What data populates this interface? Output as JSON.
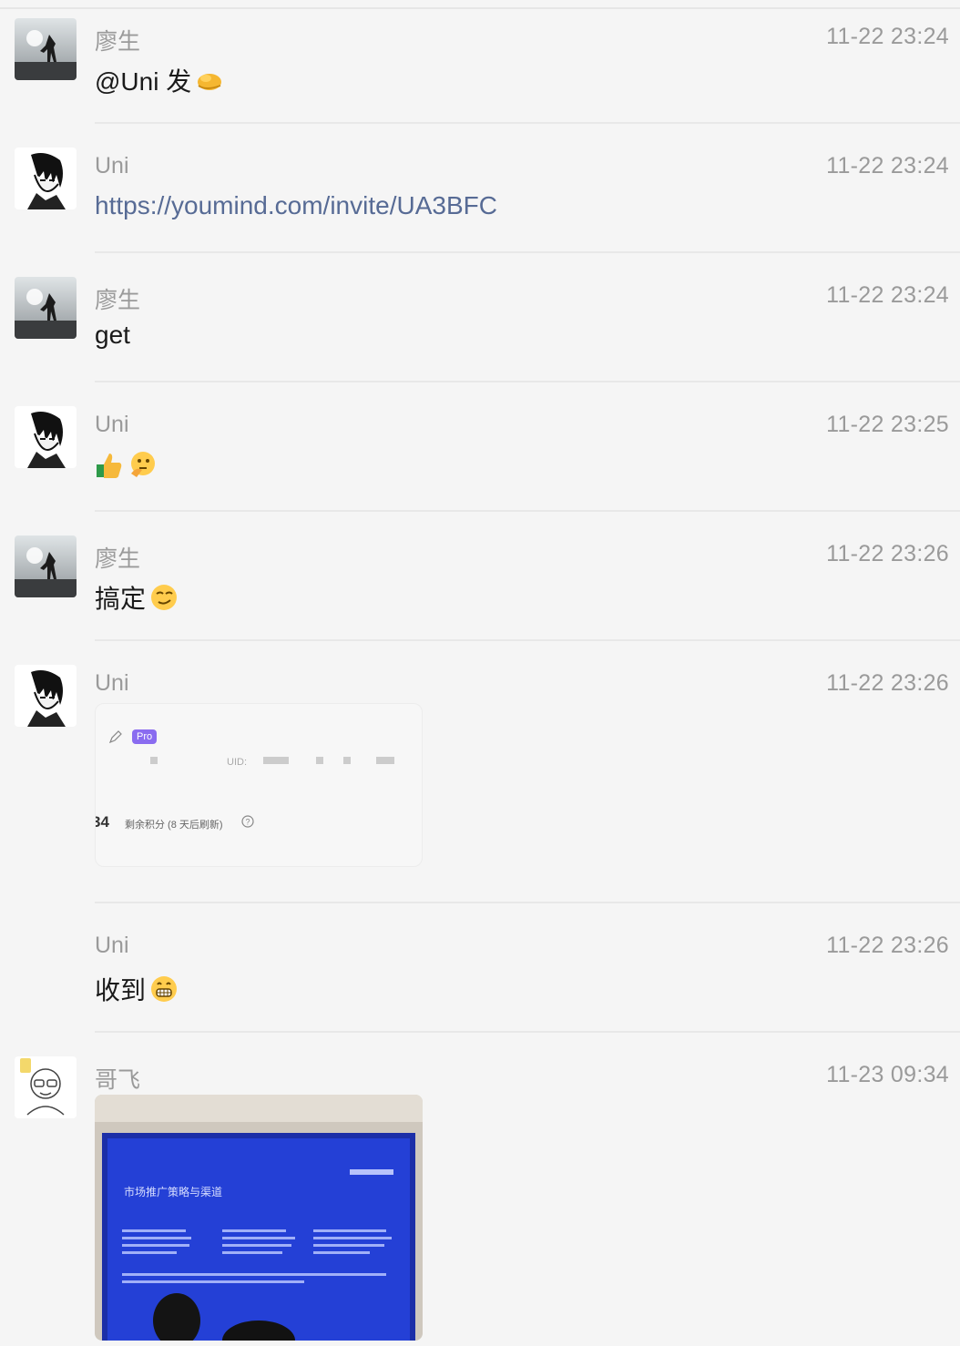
{
  "messages": [
    {
      "sender": "廖生",
      "time": "11-22 23:24",
      "text": "@Uni 发",
      "emoji_icon": "clap-hands-icon",
      "avatar_icon": "person-silhouette-avatar"
    },
    {
      "sender": "Uni",
      "time": "11-22 23:24",
      "text": "https://youmind.com/invite/UA3BFC",
      "avatar_icon": "manga-character-avatar"
    },
    {
      "sender": "廖生",
      "time": "11-22 23:24",
      "text": "get",
      "avatar_icon": "person-silhouette-avatar"
    },
    {
      "sender": "Uni",
      "time": "11-22 23:25",
      "emoji_icons": [
        "thumbs-up-icon",
        "thinking-face-icon"
      ],
      "avatar_icon": "manga-character-avatar"
    },
    {
      "sender": "廖生",
      "time": "11-22 23:26",
      "text": "搞定",
      "emoji_icon": "smirk-face-icon",
      "avatar_icon": "person-silhouette-avatar"
    },
    {
      "sender": "Uni",
      "time": "11-22 23:26",
      "card": {
        "badge": "Pro",
        "uid_label": "UID:",
        "credits_value": "34",
        "credits_label": "剩余积分 (8 天后刷新)"
      },
      "avatar_icon": "manga-character-avatar"
    },
    {
      "sender": "Uni",
      "time": "11-22 23:26",
      "text": "收到",
      "emoji_icon": "grin-face-icon"
    },
    {
      "sender": "哥飞",
      "time": "11-23 09:34",
      "image_icon": "presentation-screen-photo",
      "slide_title": "市场推广策略与渠道",
      "avatar_icon": "glasses-man-avatar"
    }
  ],
  "colors": {
    "link": "#576b95",
    "meta": "#9a9a9a",
    "pro_badge": "#8a6cf0"
  }
}
